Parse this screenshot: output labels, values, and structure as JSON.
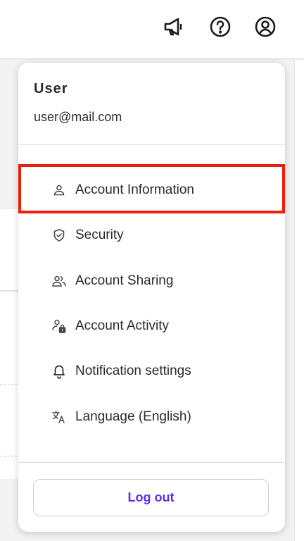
{
  "header": {
    "icons": [
      "megaphone-icon",
      "help-circle-icon",
      "user-circle-icon"
    ]
  },
  "user": {
    "name": "User",
    "email": "user@mail.com"
  },
  "menu": {
    "items": [
      {
        "label": "Account Information",
        "icon": "person-icon"
      },
      {
        "label": "Security",
        "icon": "shield-check-icon"
      },
      {
        "label": "Account Sharing",
        "icon": "users-icon"
      },
      {
        "label": "Account Activity",
        "icon": "person-lock-icon"
      },
      {
        "label": "Notification settings",
        "icon": "bell-icon"
      },
      {
        "label": "Language (English)",
        "icon": "translate-icon"
      }
    ]
  },
  "footer": {
    "logout_label": "Log out"
  },
  "colors": {
    "accent": "#5b2ff0",
    "highlight": "#e8210c",
    "text": "#2b2b2b"
  }
}
